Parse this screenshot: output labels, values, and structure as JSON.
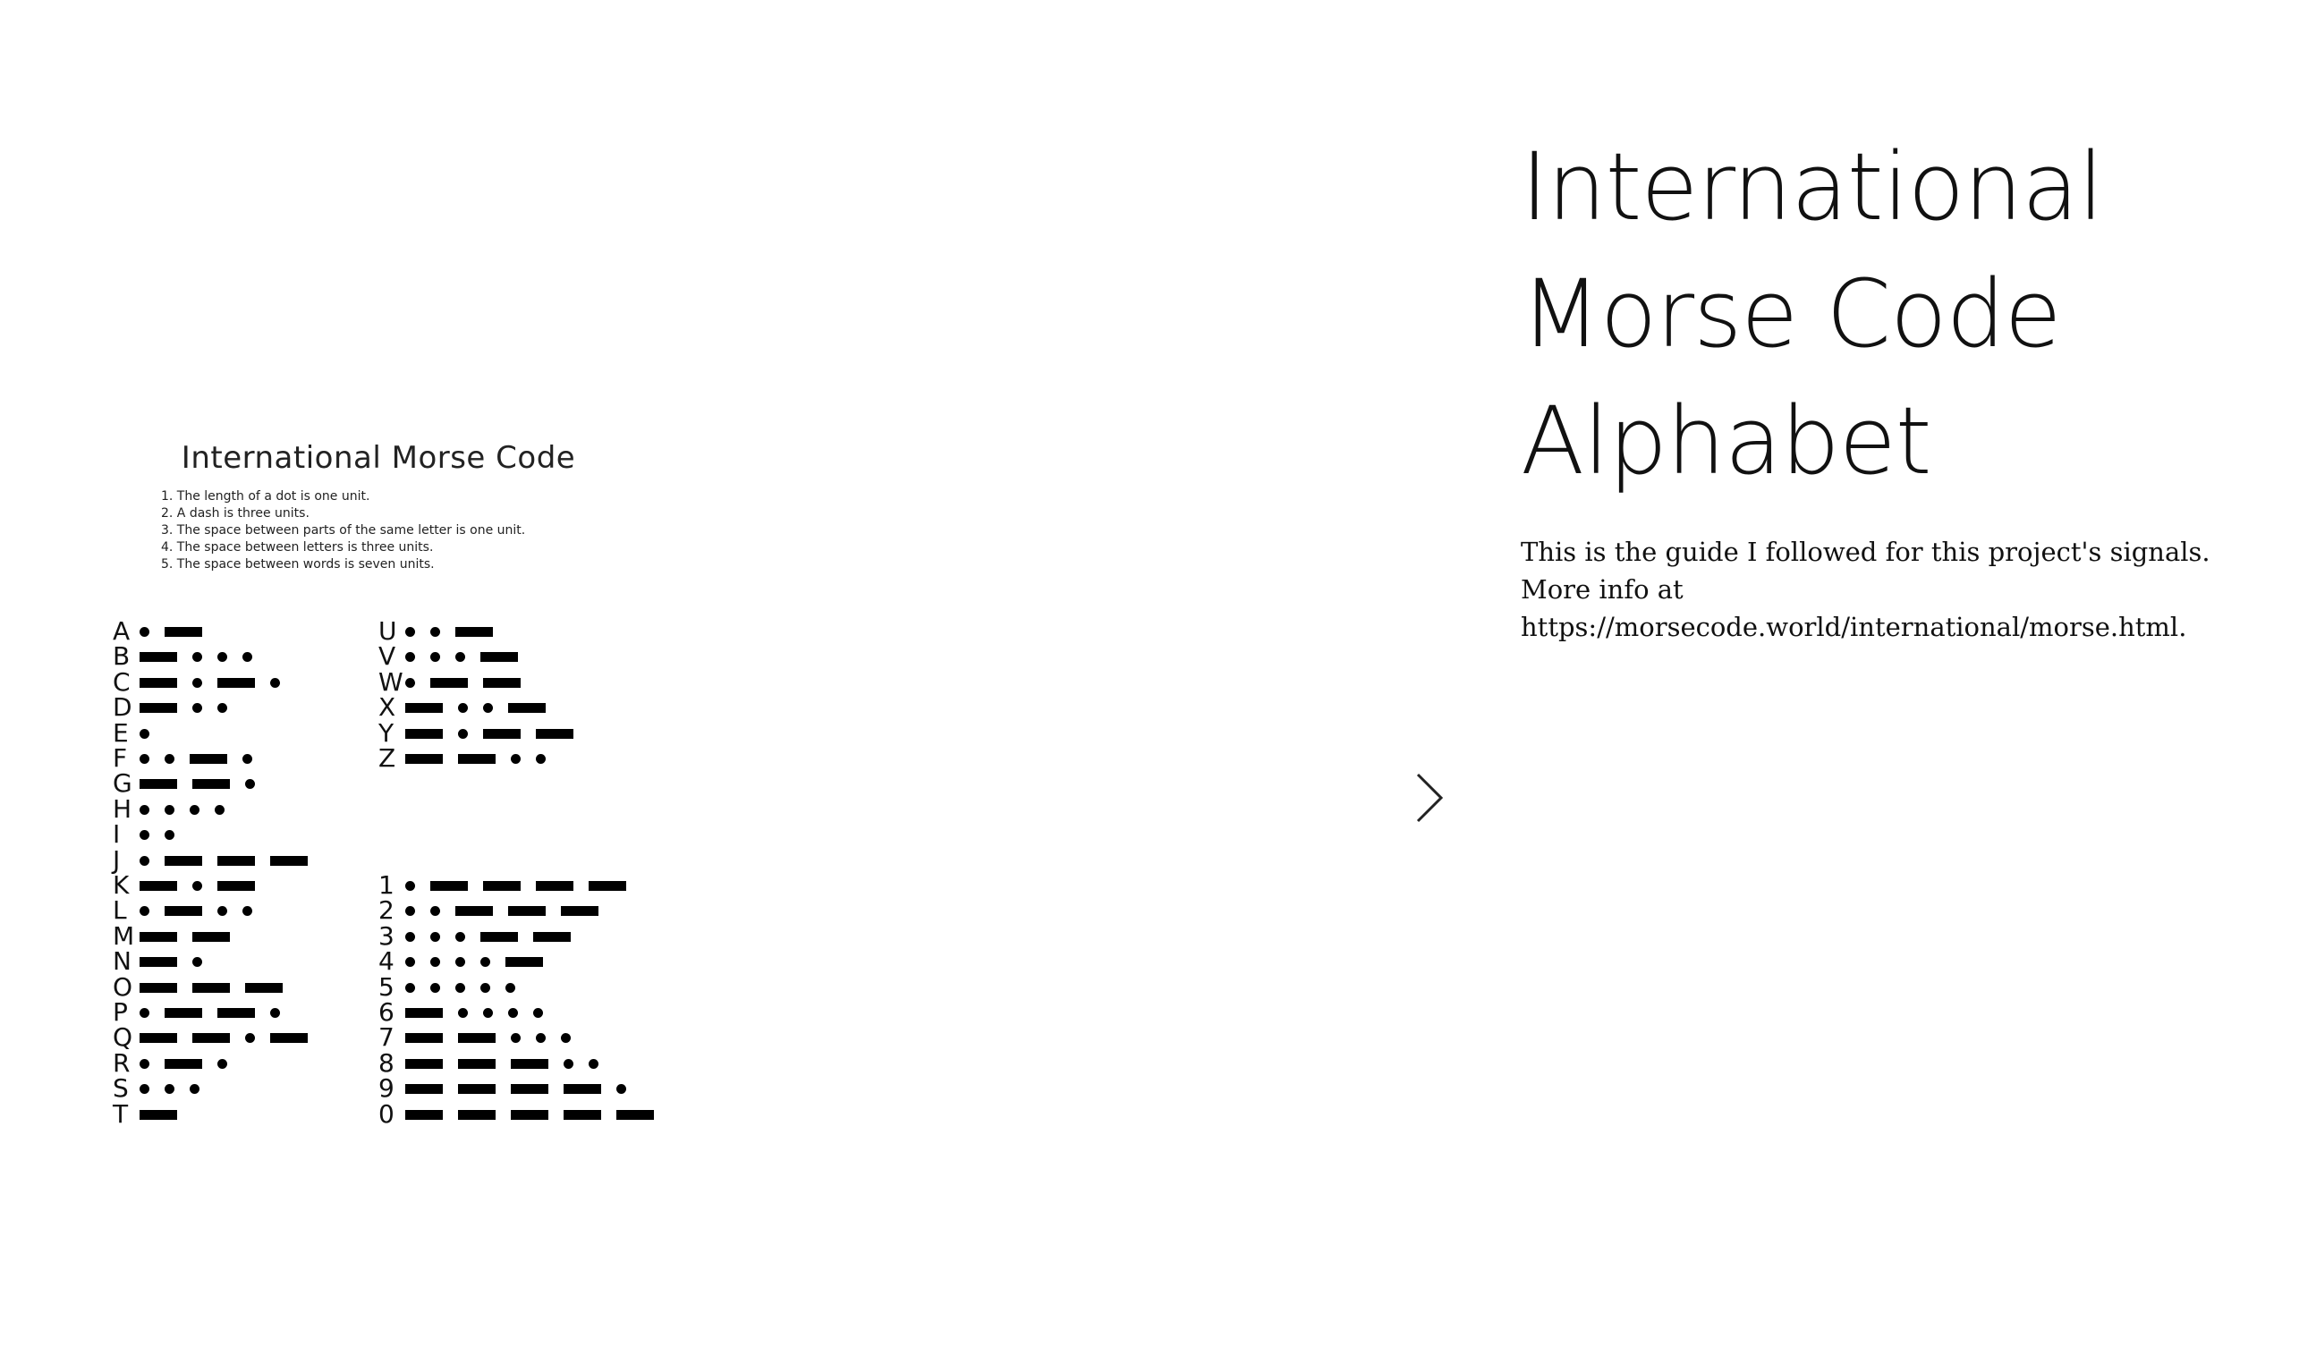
{
  "chart": {
    "title": "International Morse Code",
    "rules": [
      "1. The length of a dot is one unit.",
      "2. A dash is three units.",
      "3. The space between parts of the same letter is one unit.",
      "4. The space between letters is three units.",
      "5. The space between words is seven units."
    ],
    "letters_left": [
      {
        "char": "A",
        "code": ".-"
      },
      {
        "char": "B",
        "code": "-..."
      },
      {
        "char": "C",
        "code": "-.-."
      },
      {
        "char": "D",
        "code": "-.."
      },
      {
        "char": "E",
        "code": "."
      },
      {
        "char": "F",
        "code": "..-."
      },
      {
        "char": "G",
        "code": "--."
      },
      {
        "char": "H",
        "code": "...."
      },
      {
        "char": "I",
        "code": ".."
      },
      {
        "char": "J",
        "code": ".---"
      },
      {
        "char": "K",
        "code": "-.-"
      },
      {
        "char": "L",
        "code": ".-.."
      },
      {
        "char": "M",
        "code": "--"
      },
      {
        "char": "N",
        "code": "-."
      },
      {
        "char": "O",
        "code": "---"
      },
      {
        "char": "P",
        "code": ".--."
      },
      {
        "char": "Q",
        "code": "--.-"
      },
      {
        "char": "R",
        "code": ".-."
      },
      {
        "char": "S",
        "code": "..."
      },
      {
        "char": "T",
        "code": "-"
      }
    ],
    "letters_right": [
      {
        "char": "U",
        "code": "..-"
      },
      {
        "char": "V",
        "code": "...-"
      },
      {
        "char": "W",
        "code": ".--"
      },
      {
        "char": "X",
        "code": "-..-"
      },
      {
        "char": "Y",
        "code": "-.--"
      },
      {
        "char": "Z",
        "code": "--.."
      }
    ],
    "digits": [
      {
        "char": "1",
        "code": ".----"
      },
      {
        "char": "2",
        "code": "..---"
      },
      {
        "char": "3",
        "code": "...--"
      },
      {
        "char": "4",
        "code": "....-"
      },
      {
        "char": "5",
        "code": "....."
      },
      {
        "char": "6",
        "code": "-...."
      },
      {
        "char": "7",
        "code": "--..."
      },
      {
        "char": "8",
        "code": "---.."
      },
      {
        "char": "9",
        "code": "----."
      },
      {
        "char": "0",
        "code": "-----"
      }
    ]
  },
  "navigation": {
    "next_icon": "chevron-right-icon"
  },
  "content": {
    "heading_lines": [
      "International",
      "Morse Code",
      "Alphabet"
    ],
    "description": "This is the guide I followed for this project's signals. More info at https://morsecode.world/international/morse.html."
  }
}
